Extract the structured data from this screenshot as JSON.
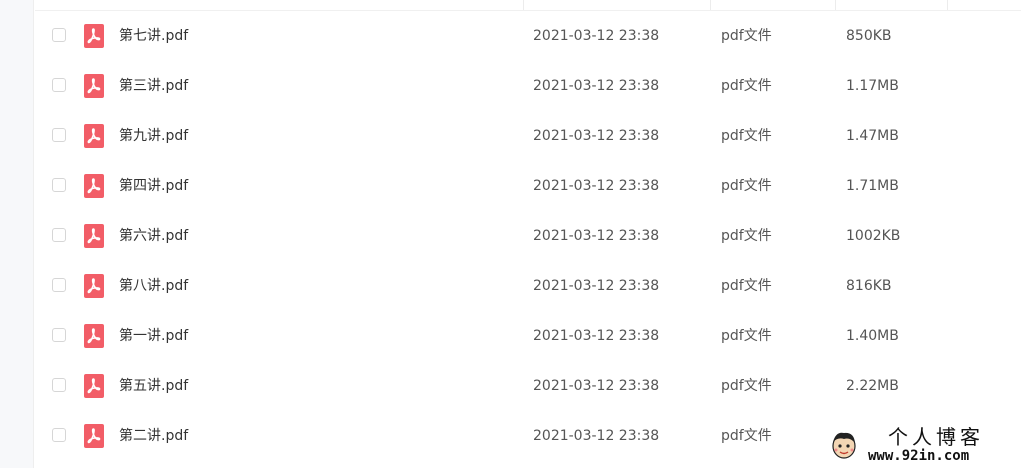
{
  "colors": {
    "accent_pdf": "#f25d67",
    "text_primary": "#333333",
    "text_secondary": "#555555"
  },
  "file_list": {
    "rows": [
      {
        "name": "第七讲.pdf",
        "date": "2021-03-12 23:38",
        "type": "pdf文件",
        "size": "850KB",
        "icon": "pdf-file-icon"
      },
      {
        "name": "第三讲.pdf",
        "date": "2021-03-12 23:38",
        "type": "pdf文件",
        "size": "1.17MB",
        "icon": "pdf-file-icon"
      },
      {
        "name": "第九讲.pdf",
        "date": "2021-03-12 23:38",
        "type": "pdf文件",
        "size": "1.47MB",
        "icon": "pdf-file-icon"
      },
      {
        "name": "第四讲.pdf",
        "date": "2021-03-12 23:38",
        "type": "pdf文件",
        "size": "1.71MB",
        "icon": "pdf-file-icon"
      },
      {
        "name": "第六讲.pdf",
        "date": "2021-03-12 23:38",
        "type": "pdf文件",
        "size": "1002KB",
        "icon": "pdf-file-icon"
      },
      {
        "name": "第八讲.pdf",
        "date": "2021-03-12 23:38",
        "type": "pdf文件",
        "size": "816KB",
        "icon": "pdf-file-icon"
      },
      {
        "name": "第一讲.pdf",
        "date": "2021-03-12 23:38",
        "type": "pdf文件",
        "size": "1.40MB",
        "icon": "pdf-file-icon"
      },
      {
        "name": "第五讲.pdf",
        "date": "2021-03-12 23:38",
        "type": "pdf文件",
        "size": "2.22MB",
        "icon": "pdf-file-icon"
      },
      {
        "name": "第二讲.pdf",
        "date": "2021-03-12 23:38",
        "type": "pdf文件",
        "size": "",
        "icon": "pdf-file-icon"
      }
    ]
  },
  "watermark": {
    "title": "个人博客",
    "url": "www.92in.com"
  }
}
